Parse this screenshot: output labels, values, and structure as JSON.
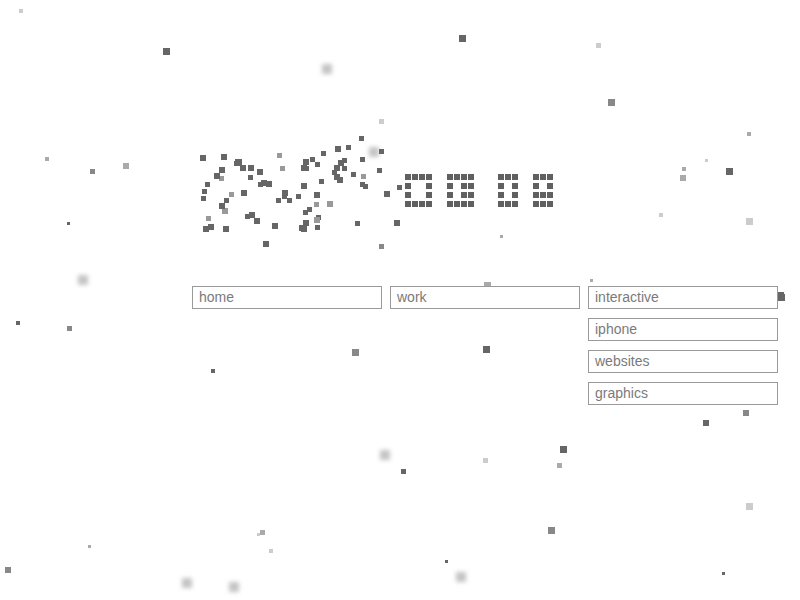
{
  "nav": {
    "items": [
      {
        "label": "home",
        "expanded": false,
        "children": []
      },
      {
        "label": "work",
        "expanded": true,
        "children": [
          {
            "label": "interactive"
          },
          {
            "label": "iphone"
          },
          {
            "label": "websites"
          },
          {
            "label": "graphics"
          }
        ]
      }
    ]
  }
}
